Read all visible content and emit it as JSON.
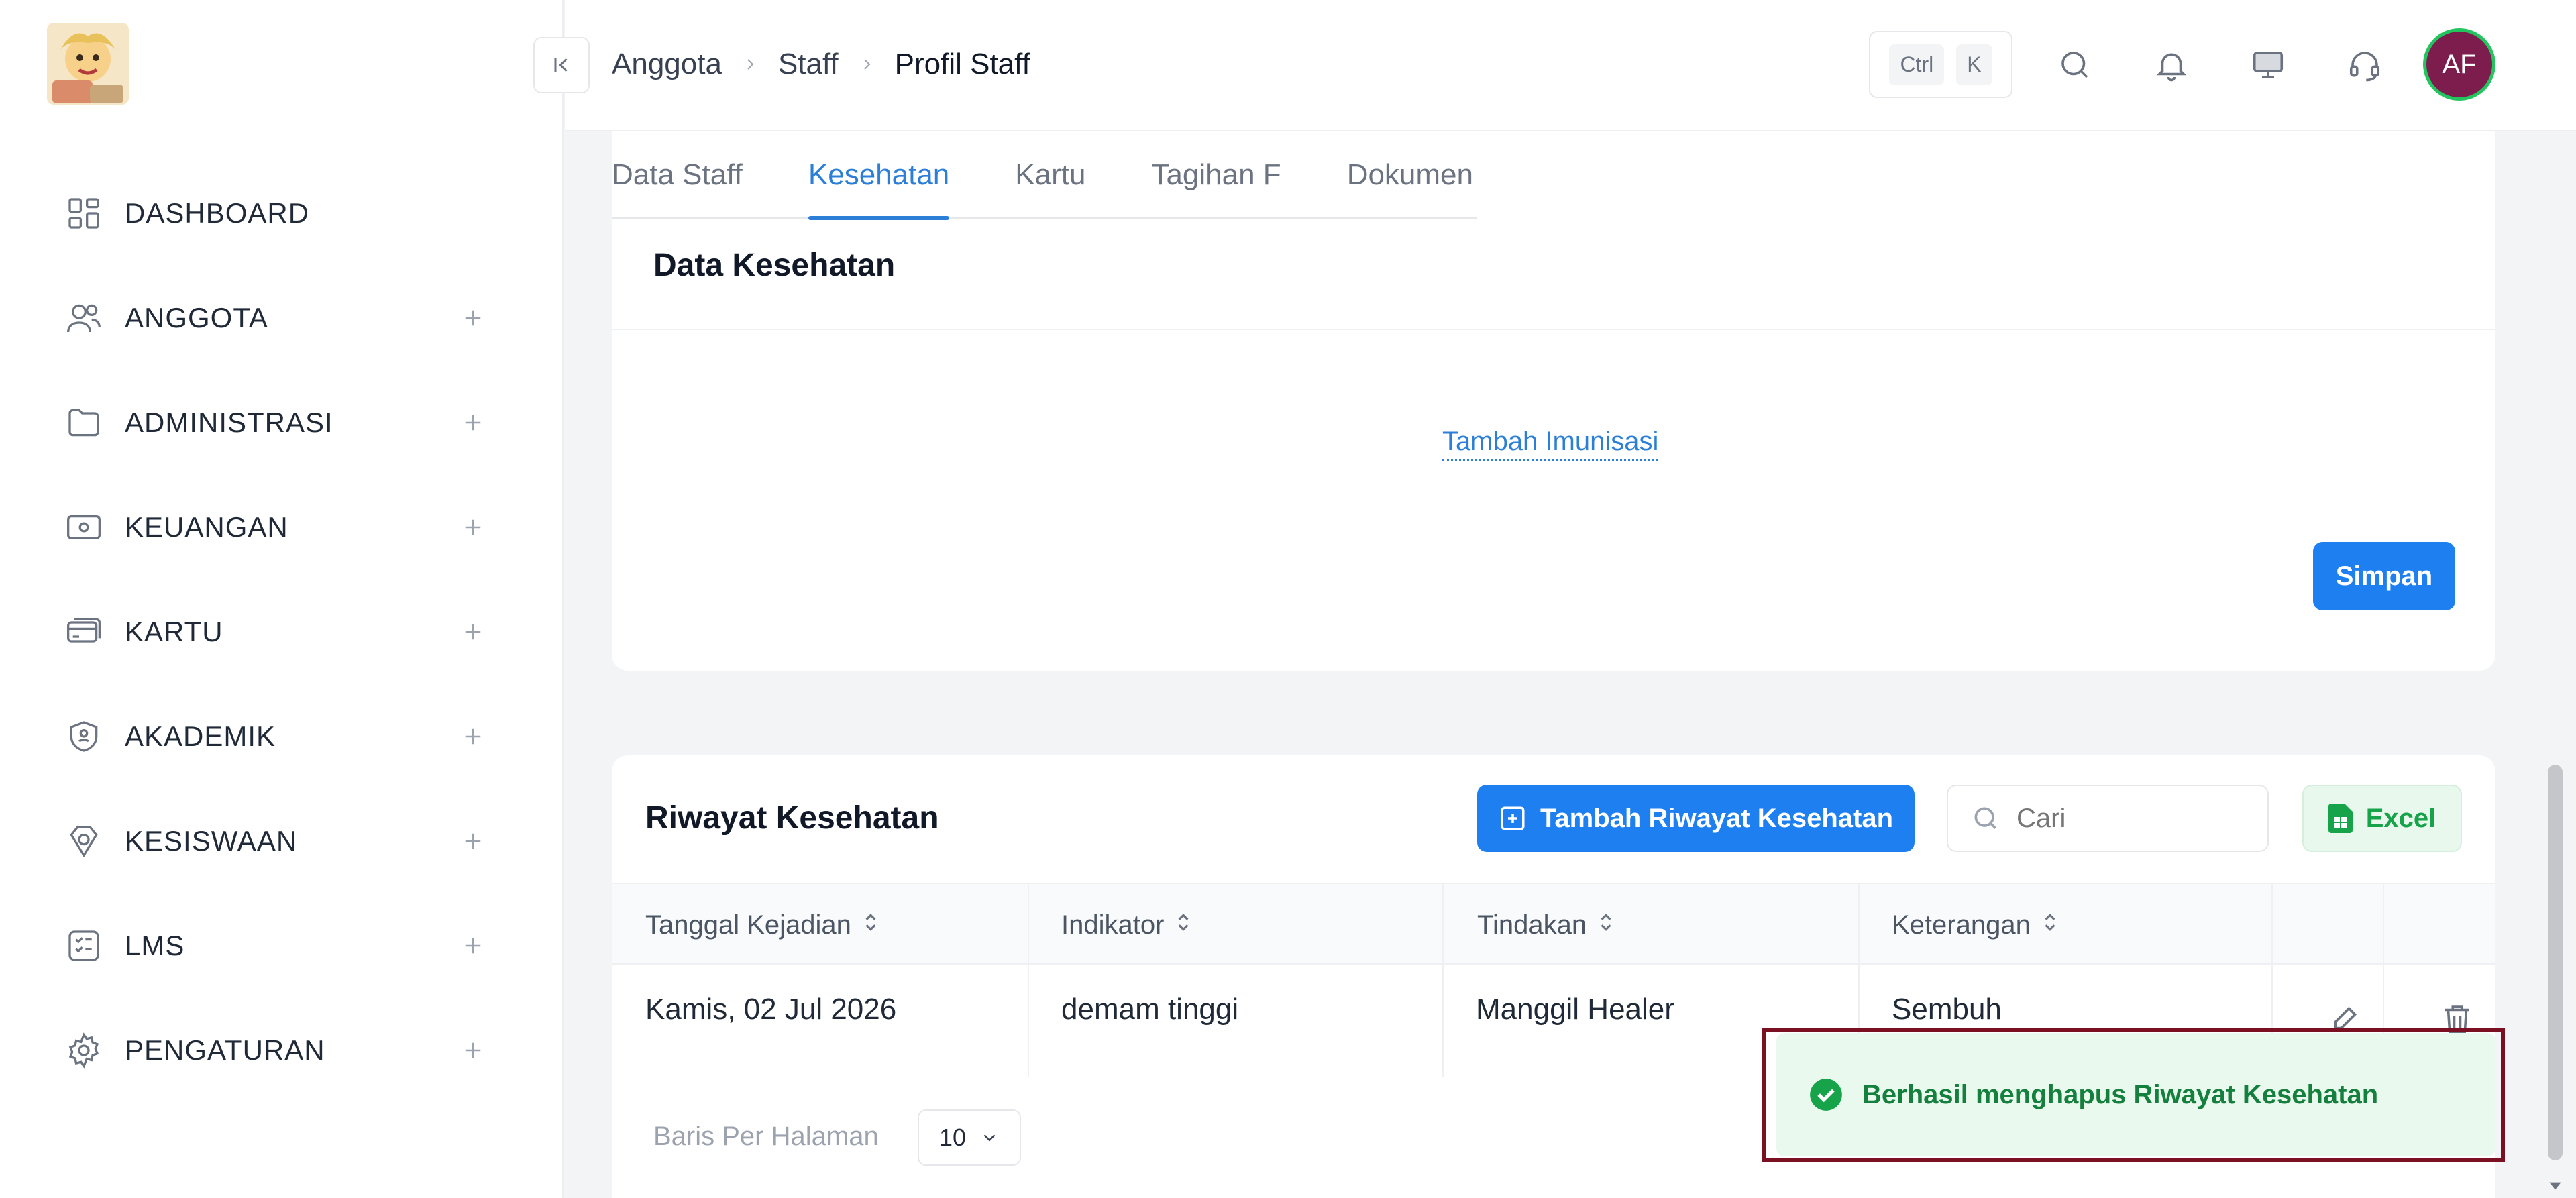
{
  "sidebar": {
    "items": [
      {
        "label": "DASHBOARD",
        "icon": "dashboard-icon",
        "expandable": false
      },
      {
        "label": "ANGGOTA",
        "icon": "users-icon",
        "expandable": true
      },
      {
        "label": "ADMINISTRASI",
        "icon": "folder-icon",
        "expandable": true
      },
      {
        "label": "KEUANGAN",
        "icon": "wallet-icon",
        "expandable": true
      },
      {
        "label": "KARTU",
        "icon": "card-icon",
        "expandable": true
      },
      {
        "label": "AKADEMIK",
        "icon": "academic-icon",
        "expandable": true
      },
      {
        "label": "KESISWAAN",
        "icon": "badge-icon",
        "expandable": true
      },
      {
        "label": "LMS",
        "icon": "checklist-icon",
        "expandable": true
      },
      {
        "label": "PENGATURAN",
        "icon": "gear-icon",
        "expandable": true
      }
    ]
  },
  "header": {
    "breadcrumb": [
      "Anggota",
      "Staff",
      "Profil Staff"
    ],
    "shortcut": {
      "ctrl": "Ctrl",
      "key": "K"
    },
    "avatar_initials": "AF"
  },
  "tabs": [
    {
      "label": "Data Staff",
      "active": false
    },
    {
      "label": "Kesehatan",
      "active": true
    },
    {
      "label": "Kartu",
      "active": false
    },
    {
      "label": "Tagihan F",
      "active": false
    },
    {
      "label": "Dokumen",
      "active": false
    }
  ],
  "health_data": {
    "title": "Data Kesehatan",
    "add_immunization_label": "Tambah Imunisasi",
    "save_label": "Simpan"
  },
  "history": {
    "title": "Riwayat Kesehatan",
    "add_label": "Tambah Riwayat Kesehatan",
    "search_placeholder": "Cari",
    "excel_label": "Excel",
    "columns": [
      "Tanggal Kejadian",
      "Indikator",
      "Tindakan",
      "Keterangan"
    ],
    "rows": [
      {
        "date": "Kamis, 02 Jul 2026",
        "indicator": "demam tinggi",
        "action": "Manggil Healer",
        "note": "Sembuh"
      }
    ],
    "rows_per_page_label": "Baris Per Halaman",
    "rows_per_page_value": "10"
  },
  "toast": {
    "message": "Berhasil menghapus Riwayat Kesehatan",
    "status": "success"
  },
  "colors": {
    "primary": "#1e7ff0",
    "active_tab": "#2b7fd6",
    "success": "#16a34a",
    "avatar_bg": "#7c1d4e"
  }
}
